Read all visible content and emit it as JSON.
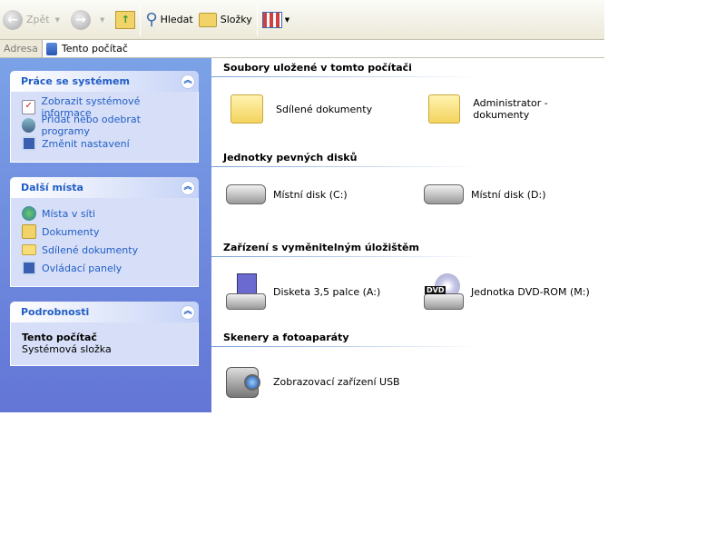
{
  "toolbar": {
    "back": "Zpět",
    "search": "Hledat",
    "folders": "Složky"
  },
  "address": {
    "label": "Adresa",
    "value": "Tento počítač"
  },
  "tasks": {
    "system": {
      "title": "Práce se systémem",
      "items": [
        "Zobrazit systémové informace",
        "Přidat nebo odebrat programy",
        "Změnit nastavení"
      ]
    },
    "places": {
      "title": "Další místa",
      "items": [
        "Místa v síti",
        "Dokumenty",
        "Sdílené dokumenty",
        "Ovládací panely"
      ]
    },
    "details": {
      "title": "Podrobnosti",
      "name": "Tento počítač",
      "desc": "Systémová složka"
    }
  },
  "sections": [
    {
      "title": "Soubory uložené v tomto počítači",
      "items": [
        "Sdílené dokumenty",
        "Administrator - dokumenty"
      ]
    },
    {
      "title": "Jednotky pevných disků",
      "items": [
        "Místní disk (C:)",
        "Místní disk (D:)"
      ]
    },
    {
      "title": "Zařízení s vyměnitelným úložištěm",
      "items": [
        "Disketa 3,5 palce (A:)",
        "Jednotka DVD-ROM (M:)"
      ],
      "dvd_badge": "DVD"
    },
    {
      "title": "Skenery a fotoaparáty",
      "items": [
        "Zobrazovací zařízení USB"
      ]
    }
  ]
}
